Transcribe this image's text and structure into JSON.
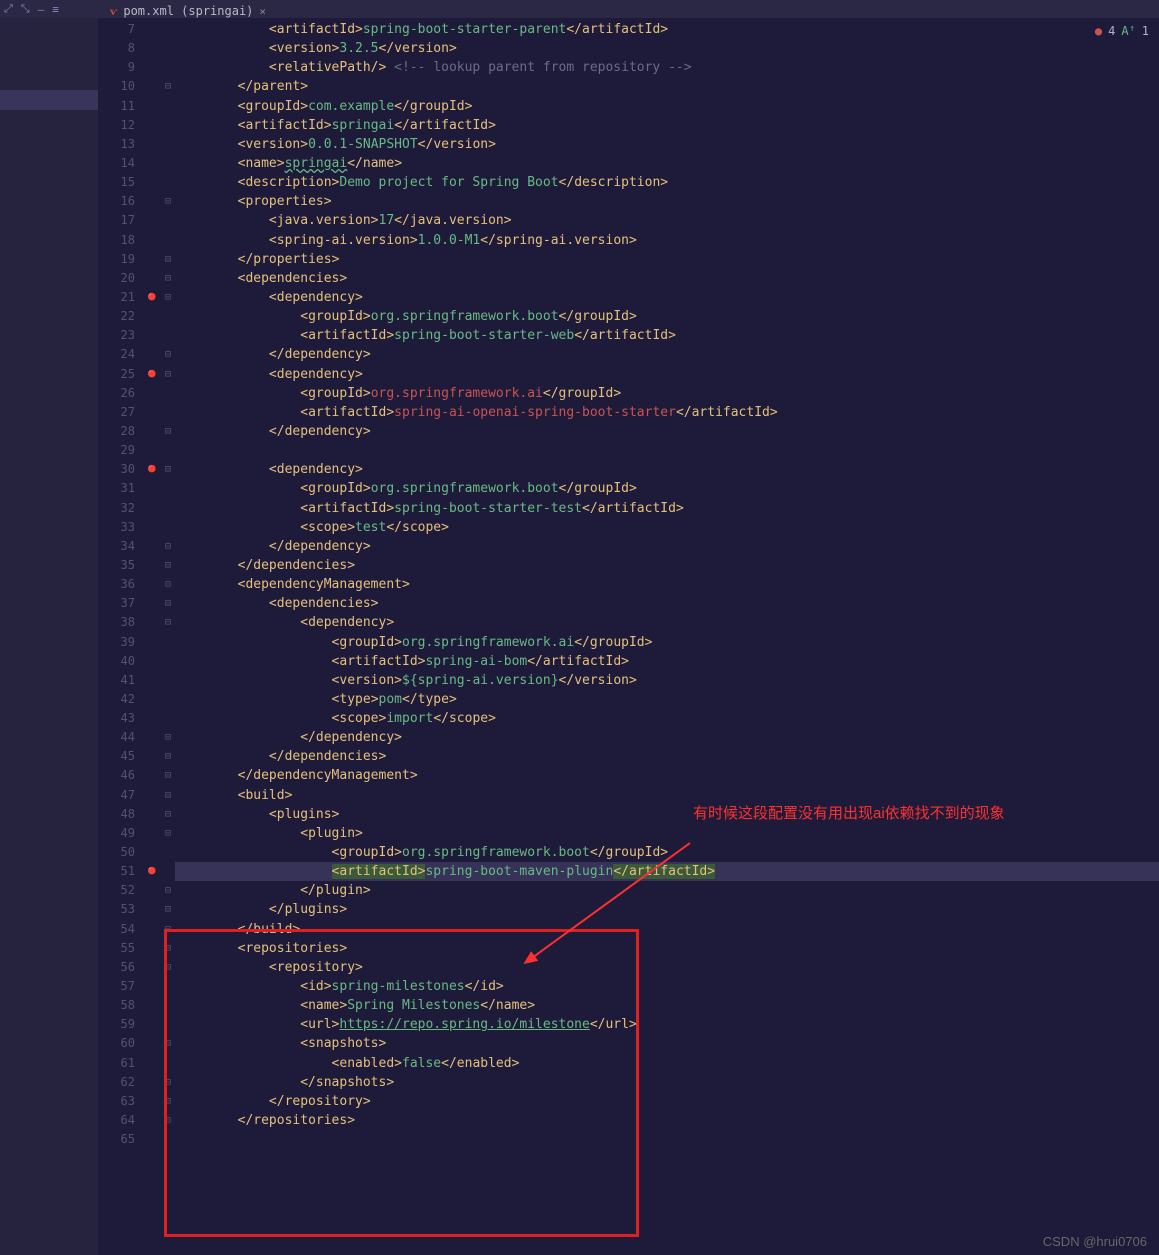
{
  "tab": {
    "filename": "pom.xml (springai)"
  },
  "status": {
    "errors": "4",
    "warnings": "",
    "typos": "1"
  },
  "annotation": {
    "text": "有时候这段配置没有用出现ai依赖找不到的现象"
  },
  "watermark": "CSDN @hrui0706",
  "lines": [
    {
      "n": "7",
      "f": "",
      "g": "",
      "html": "            <span class='t-brk'>&lt;</span><span class='t-tag'>artifactId</span><span class='t-brk'>&gt;</span><span class='t-txt'>spring-boot-starter-parent</span><span class='t-brk'>&lt;/</span><span class='t-tag'>artifactId</span><span class='t-brk'>&gt;</span>"
    },
    {
      "n": "8",
      "f": "",
      "g": "",
      "html": "            <span class='t-brk'>&lt;</span><span class='t-tag'>version</span><span class='t-brk'>&gt;</span><span class='t-txt'>3.2.5</span><span class='t-brk'>&lt;/</span><span class='t-tag'>version</span><span class='t-brk'>&gt;</span>"
    },
    {
      "n": "9",
      "f": "",
      "g": "",
      "html": "            <span class='t-brk'>&lt;</span><span class='t-tag'>relativePath</span><span class='t-brk'>/&gt;</span> <span class='t-cmt'>&lt;!-- lookup parent from repository --&gt;</span>"
    },
    {
      "n": "10",
      "f": "⊟",
      "g": "",
      "html": "        <span class='t-brk'>&lt;/</span><span class='t-tag'>parent</span><span class='t-brk'>&gt;</span>"
    },
    {
      "n": "11",
      "f": "",
      "g": "",
      "html": "        <span class='t-brk'>&lt;</span><span class='t-tag'>groupId</span><span class='t-brk'>&gt;</span><span class='t-txt'>com.example</span><span class='t-brk'>&lt;/</span><span class='t-tag'>groupId</span><span class='t-brk'>&gt;</span>"
    },
    {
      "n": "12",
      "f": "",
      "g": "",
      "html": "        <span class='t-brk'>&lt;</span><span class='t-tag'>artifactId</span><span class='t-brk'>&gt;</span><span class='t-txt'>springai</span><span class='t-brk'>&lt;/</span><span class='t-tag'>artifactId</span><span class='t-brk'>&gt;</span>"
    },
    {
      "n": "13",
      "f": "",
      "g": "",
      "html": "        <span class='t-brk'>&lt;</span><span class='t-tag'>version</span><span class='t-brk'>&gt;</span><span class='t-txt'>0.0.1-SNAPSHOT</span><span class='t-brk'>&lt;/</span><span class='t-tag'>version</span><span class='t-brk'>&gt;</span>"
    },
    {
      "n": "14",
      "f": "",
      "g": "",
      "html": "        <span class='t-brk'>&lt;</span><span class='t-tag'>name</span><span class='t-brk'>&gt;</span><span class='t-name-u'>springai</span><span class='t-brk'>&lt;/</span><span class='t-tag'>name</span><span class='t-brk'>&gt;</span>"
    },
    {
      "n": "15",
      "f": "",
      "g": "",
      "html": "        <span class='t-brk'>&lt;</span><span class='t-tag'>description</span><span class='t-brk'>&gt;</span><span class='t-txt'>Demo project for Spring Boot</span><span class='t-brk'>&lt;/</span><span class='t-tag'>description</span><span class='t-brk'>&gt;</span>"
    },
    {
      "n": "16",
      "f": "⊟",
      "g": "",
      "html": "        <span class='t-brk'>&lt;</span><span class='t-tag'>properties</span><span class='t-brk'>&gt;</span>"
    },
    {
      "n": "17",
      "f": "",
      "g": "",
      "html": "            <span class='t-brk'>&lt;</span><span class='t-tag'>java.version</span><span class='t-brk'>&gt;</span><span class='t-txt'>17</span><span class='t-brk'>&lt;/</span><span class='t-tag'>java.version</span><span class='t-brk'>&gt;</span>"
    },
    {
      "n": "18",
      "f": "",
      "g": "",
      "html": "            <span class='t-brk'>&lt;</span><span class='t-tag'>spring-ai.version</span><span class='t-brk'>&gt;</span><span class='t-txt'>1.0.0-M1</span><span class='t-brk'>&lt;/</span><span class='t-tag'>spring-ai.version</span><span class='t-brk'>&gt;</span>"
    },
    {
      "n": "19",
      "f": "⊟",
      "g": "",
      "html": "        <span class='t-brk'>&lt;/</span><span class='t-tag'>properties</span><span class='t-brk'>&gt;</span>"
    },
    {
      "n": "20",
      "f": "⊟",
      "g": "",
      "html": "        <span class='t-brk'>&lt;</span><span class='t-tag'>dependencies</span><span class='t-brk'>&gt;</span>"
    },
    {
      "n": "21",
      "f": "⊟",
      "g": "m",
      "html": "            <span class='t-brk'>&lt;</span><span class='t-tag'>dependency</span><span class='t-brk'>&gt;</span>"
    },
    {
      "n": "22",
      "f": "",
      "g": "",
      "html": "                <span class='t-brk'>&lt;</span><span class='t-tag'>groupId</span><span class='t-brk'>&gt;</span><span class='t-txt'>org.springframework.boot</span><span class='t-brk'>&lt;/</span><span class='t-tag'>groupId</span><span class='t-brk'>&gt;</span>"
    },
    {
      "n": "23",
      "f": "",
      "g": "",
      "html": "                <span class='t-brk'>&lt;</span><span class='t-tag'>artifactId</span><span class='t-brk'>&gt;</span><span class='t-txt'>spring-boot-starter-web</span><span class='t-brk'>&lt;/</span><span class='t-tag'>artifactId</span><span class='t-brk'>&gt;</span>"
    },
    {
      "n": "24",
      "f": "⊟",
      "g": "",
      "html": "            <span class='t-brk'>&lt;/</span><span class='t-tag'>dependency</span><span class='t-brk'>&gt;</span>"
    },
    {
      "n": "25",
      "f": "⊟",
      "g": "m",
      "html": "            <span class='t-brk'>&lt;</span><span class='t-tag'>dependency</span><span class='t-brk'>&gt;</span>"
    },
    {
      "n": "26",
      "f": "",
      "g": "",
      "html": "                <span class='t-brk'>&lt;</span><span class='t-tag'>groupId</span><span class='t-brk'>&gt;</span><span class='t-err'>org.springframework.ai</span><span class='t-brk'>&lt;/</span><span class='t-tag'>groupId</span><span class='t-brk'>&gt;</span>"
    },
    {
      "n": "27",
      "f": "",
      "g": "",
      "html": "                <span class='t-brk'>&lt;</span><span class='t-tag'>artifactId</span><span class='t-brk'>&gt;</span><span class='t-err'>spring-ai-openai-spring-boot-starter</span><span class='t-brk'>&lt;/</span><span class='t-tag'>artifactId</span><span class='t-brk'>&gt;</span>"
    },
    {
      "n": "28",
      "f": "⊟",
      "g": "",
      "html": "            <span class='t-brk'>&lt;/</span><span class='t-tag'>dependency</span><span class='t-brk'>&gt;</span>"
    },
    {
      "n": "29",
      "f": "",
      "g": "",
      "html": ""
    },
    {
      "n": "30",
      "f": "⊟",
      "g": "m",
      "html": "            <span class='t-brk'>&lt;</span><span class='t-tag'>dependency</span><span class='t-brk'>&gt;</span>"
    },
    {
      "n": "31",
      "f": "",
      "g": "",
      "html": "                <span class='t-brk'>&lt;</span><span class='t-tag'>groupId</span><span class='t-brk'>&gt;</span><span class='t-txt'>org.springframework.boot</span><span class='t-brk'>&lt;/</span><span class='t-tag'>groupId</span><span class='t-brk'>&gt;</span>"
    },
    {
      "n": "32",
      "f": "",
      "g": "",
      "html": "                <span class='t-brk'>&lt;</span><span class='t-tag'>artifactId</span><span class='t-brk'>&gt;</span><span class='t-txt'>spring-boot-starter-test</span><span class='t-brk'>&lt;/</span><span class='t-tag'>artifactId</span><span class='t-brk'>&gt;</span>"
    },
    {
      "n": "33",
      "f": "",
      "g": "",
      "html": "                <span class='t-brk'>&lt;</span><span class='t-tag'>scope</span><span class='t-brk'>&gt;</span><span class='t-txt'>test</span><span class='t-brk'>&lt;/</span><span class='t-tag'>scope</span><span class='t-brk'>&gt;</span>"
    },
    {
      "n": "34",
      "f": "⊟",
      "g": "",
      "html": "            <span class='t-brk'>&lt;/</span><span class='t-tag'>dependency</span><span class='t-brk'>&gt;</span>"
    },
    {
      "n": "35",
      "f": "⊟",
      "g": "",
      "html": "        <span class='t-brk'>&lt;/</span><span class='t-tag'>dependencies</span><span class='t-brk'>&gt;</span>"
    },
    {
      "n": "36",
      "f": "⊟",
      "g": "",
      "html": "        <span class='t-brk'>&lt;</span><span class='t-tag'>dependencyManagement</span><span class='t-brk'>&gt;</span>"
    },
    {
      "n": "37",
      "f": "⊟",
      "g": "",
      "html": "            <span class='t-brk'>&lt;</span><span class='t-tag'>dependencies</span><span class='t-brk'>&gt;</span>"
    },
    {
      "n": "38",
      "f": "⊟",
      "g": "",
      "html": "                <span class='t-brk'>&lt;</span><span class='t-tag'>dependency</span><span class='t-brk'>&gt;</span>"
    },
    {
      "n": "39",
      "f": "",
      "g": "",
      "html": "                    <span class='t-brk'>&lt;</span><span class='t-tag'>groupId</span><span class='t-brk'>&gt;</span><span class='t-txt'>org.springframework.ai</span><span class='t-brk'>&lt;/</span><span class='t-tag'>groupId</span><span class='t-brk'>&gt;</span>"
    },
    {
      "n": "40",
      "f": "",
      "g": "",
      "html": "                    <span class='t-brk'>&lt;</span><span class='t-tag'>artifactId</span><span class='t-brk'>&gt;</span><span class='t-txt'>spring-ai-bom</span><span class='t-brk'>&lt;/</span><span class='t-tag'>artifactId</span><span class='t-brk'>&gt;</span>"
    },
    {
      "n": "41",
      "f": "",
      "g": "",
      "html": "                    <span class='t-brk'>&lt;</span><span class='t-tag'>version</span><span class='t-brk'>&gt;</span><span class='t-txt'>${spring-ai.version}</span><span class='t-brk'>&lt;/</span><span class='t-tag'>version</span><span class='t-brk'>&gt;</span>"
    },
    {
      "n": "42",
      "f": "",
      "g": "",
      "html": "                    <span class='t-brk'>&lt;</span><span class='t-tag'>type</span><span class='t-brk'>&gt;</span><span class='t-txt'>pom</span><span class='t-brk'>&lt;/</span><span class='t-tag'>type</span><span class='t-brk'>&gt;</span>"
    },
    {
      "n": "43",
      "f": "",
      "g": "",
      "html": "                    <span class='t-brk'>&lt;</span><span class='t-tag'>scope</span><span class='t-brk'>&gt;</span><span class='t-txt'>import</span><span class='t-brk'>&lt;/</span><span class='t-tag'>scope</span><span class='t-brk'>&gt;</span>"
    },
    {
      "n": "44",
      "f": "⊟",
      "g": "",
      "html": "                <span class='t-brk'>&lt;/</span><span class='t-tag'>dependency</span><span class='t-brk'>&gt;</span>"
    },
    {
      "n": "45",
      "f": "⊟",
      "g": "",
      "html": "            <span class='t-brk'>&lt;/</span><span class='t-tag'>dependencies</span><span class='t-brk'>&gt;</span>"
    },
    {
      "n": "46",
      "f": "⊟",
      "g": "",
      "html": "        <span class='t-brk'>&lt;/</span><span class='t-tag'>dependencyManagement</span><span class='t-brk'>&gt;</span>"
    },
    {
      "n": "47",
      "f": "⊟",
      "g": "",
      "html": "        <span class='t-brk'>&lt;</span><span class='t-tag'>build</span><span class='t-brk'>&gt;</span>"
    },
    {
      "n": "48",
      "f": "⊟",
      "g": "",
      "html": "            <span class='t-brk'>&lt;</span><span class='t-tag'>plugins</span><span class='t-brk'>&gt;</span>"
    },
    {
      "n": "49",
      "f": "⊟",
      "g": "",
      "html": "                <span class='t-brk'>&lt;</span><span class='t-tag'>plugin</span><span class='t-brk'>&gt;</span>"
    },
    {
      "n": "50",
      "f": "",
      "g": "",
      "html": "                    <span class='t-brk'>&lt;</span><span class='t-tag'>groupId</span><span class='t-brk'>&gt;</span><span class='t-txt'>org.springframework.boot</span><span class='t-brk'>&lt;/</span><span class='t-tag'>groupId</span><span class='t-brk'>&gt;</span>"
    },
    {
      "n": "51",
      "f": "",
      "g": "m",
      "hl": true,
      "html": "                    <span class='sel-bg'><span class='t-brk'>&lt;</span><span class='t-tag'>artifactId</span><span class='t-brk'>&gt;</span></span><span class='t-txt'>spring-boot-maven-plugin</span><span class='sel-bg'><span class='t-brk'>&lt;/</span><span class='t-tag'>artifactId</span><span class='t-brk'>&gt;</span></span>"
    },
    {
      "n": "52",
      "f": "⊟",
      "g": "",
      "html": "                <span class='t-brk'>&lt;/</span><span class='t-tag'>plugin</span><span class='t-brk'>&gt;</span>"
    },
    {
      "n": "53",
      "f": "⊟",
      "g": "",
      "html": "            <span class='t-brk'>&lt;/</span><span class='t-tag'>plugins</span><span class='t-brk'>&gt;</span>"
    },
    {
      "n": "54",
      "f": "⊟",
      "g": "",
      "html": "        <span class='t-brk'>&lt;/</span><span class='t-tag'>build</span><span class='t-brk'>&gt;</span>"
    },
    {
      "n": "55",
      "f": "⊟",
      "g": "",
      "html": "        <span class='t-brk'>&lt;</span><span class='t-tag'>repositories</span><span class='t-brk'>&gt;</span>"
    },
    {
      "n": "56",
      "f": "⊟",
      "g": "",
      "html": "            <span class='t-brk'>&lt;</span><span class='t-tag'>repository</span><span class='t-brk'>&gt;</span>"
    },
    {
      "n": "57",
      "f": "",
      "g": "",
      "html": "                <span class='t-brk'>&lt;</span><span class='t-tag'>id</span><span class='t-brk'>&gt;</span><span class='t-txt'>spring-milestones</span><span class='t-brk'>&lt;/</span><span class='t-tag'>id</span><span class='t-brk'>&gt;</span>"
    },
    {
      "n": "58",
      "f": "",
      "g": "",
      "html": "                <span class='t-brk'>&lt;</span><span class='t-tag'>name</span><span class='t-brk'>&gt;</span><span class='t-txt'>Spring Milestones</span><span class='t-brk'>&lt;/</span><span class='t-tag'>name</span><span class='t-brk'>&gt;</span>"
    },
    {
      "n": "59",
      "f": "",
      "g": "",
      "html": "                <span class='t-brk'>&lt;</span><span class='t-tag'>url</span><span class='t-brk'>&gt;</span><span class='t-url'>https://repo.spring.io/milestone</span><span class='t-brk'>&lt;/</span><span class='t-tag'>url</span><span class='t-brk'>&gt;</span>"
    },
    {
      "n": "60",
      "f": "⊟",
      "g": "",
      "html": "                <span class='t-brk'>&lt;</span><span class='t-tag'>snapshots</span><span class='t-brk'>&gt;</span>"
    },
    {
      "n": "61",
      "f": "",
      "g": "",
      "html": "                    <span class='t-brk'>&lt;</span><span class='t-tag'>enabled</span><span class='t-brk'>&gt;</span><span class='t-txt'>false</span><span class='t-brk'>&lt;/</span><span class='t-tag'>enabled</span><span class='t-brk'>&gt;</span>"
    },
    {
      "n": "62",
      "f": "⊟",
      "g": "",
      "html": "                <span class='t-brk'>&lt;/</span><span class='t-tag'>snapshots</span><span class='t-brk'>&gt;</span>"
    },
    {
      "n": "63",
      "f": "⊟",
      "g": "",
      "html": "            <span class='t-brk'>&lt;/</span><span class='t-tag'>repository</span><span class='t-brk'>&gt;</span>"
    },
    {
      "n": "64",
      "f": "⊟",
      "g": "",
      "html": "        <span class='t-brk'>&lt;/</span><span class='t-tag'>repositories</span><span class='t-brk'>&gt;</span>"
    },
    {
      "n": "65",
      "f": "",
      "g": "",
      "html": ""
    }
  ]
}
